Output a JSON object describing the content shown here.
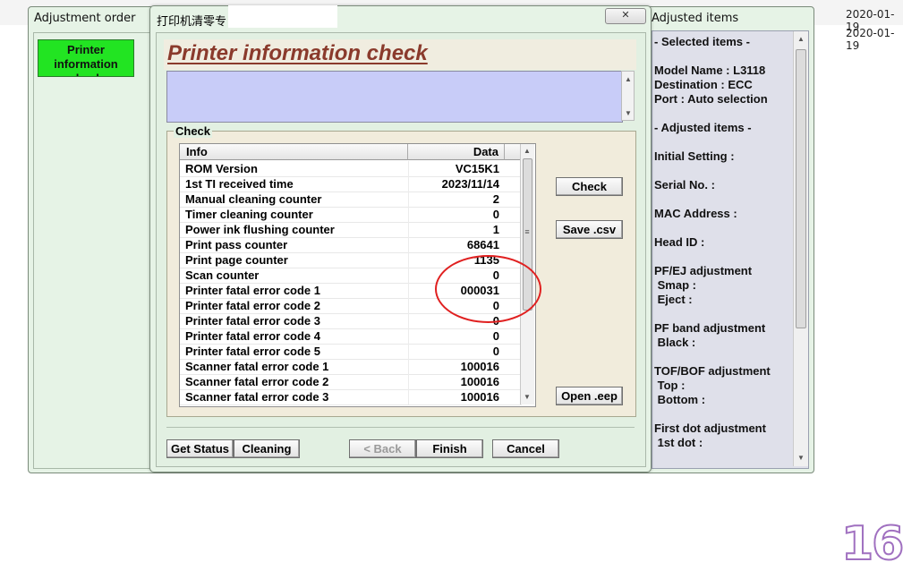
{
  "background": {
    "dates": [
      "2020-01-19",
      "2020-01-19"
    ]
  },
  "outer_window": {
    "left_title": "Adjustment order",
    "right_title": "Adjusted items",
    "order_button": "Printer information check"
  },
  "adjusted_items": {
    "lines": [
      "- Selected items -",
      "",
      "Model Name : L3118",
      "Destination : ECC",
      "Port : Auto selection",
      "",
      "- Adjusted items -",
      "",
      "Initial Setting :",
      "",
      "Serial No. :",
      "",
      "MAC Address :",
      "",
      "Head ID :",
      "",
      "PF/EJ adjustment",
      " Smap :",
      " Eject :",
      "",
      "PF band adjustment",
      " Black :",
      "",
      "TOF/BOF adjustment",
      " Top :",
      " Bottom :",
      "",
      "First dot adjustment",
      " 1st dot :"
    ]
  },
  "dialog": {
    "title": "打印机清零专",
    "close_label": "✕",
    "heading": "Printer information check",
    "group_label": "Check",
    "table": {
      "headers": [
        "Info",
        "Data"
      ],
      "rows": [
        [
          "ROM Version",
          "VC15K1"
        ],
        [
          "1st TI received time",
          "2023/11/14"
        ],
        [
          "Manual cleaning counter",
          "2"
        ],
        [
          "Timer cleaning counter",
          "0"
        ],
        [
          "Power ink flushing counter",
          "1"
        ],
        [
          "Print pass counter",
          "68641"
        ],
        [
          "Print page counter",
          "1135"
        ],
        [
          "Scan counter",
          "0"
        ],
        [
          "Printer fatal error code 1",
          "000031"
        ],
        [
          "Printer fatal error code 2",
          "0"
        ],
        [
          "Printer fatal error code 3",
          "0"
        ],
        [
          "Printer fatal error code 4",
          "0"
        ],
        [
          "Printer fatal error code 5",
          "0"
        ],
        [
          "Scanner fatal error code 1",
          "100016"
        ],
        [
          "Scanner fatal error code 2",
          "100016"
        ],
        [
          "Scanner fatal error code 3",
          "100016"
        ]
      ]
    },
    "side_buttons": {
      "check": "Check",
      "save_csv": "Save .csv",
      "open_eep": "Open .eep"
    },
    "bottom_buttons": {
      "get_status": "Get Status",
      "cleaning": "Cleaning",
      "back": "< Back",
      "finish": "Finish",
      "cancel": "Cancel"
    }
  },
  "overlay": {
    "page_number": "16",
    "annotation_color": "#e02020"
  }
}
